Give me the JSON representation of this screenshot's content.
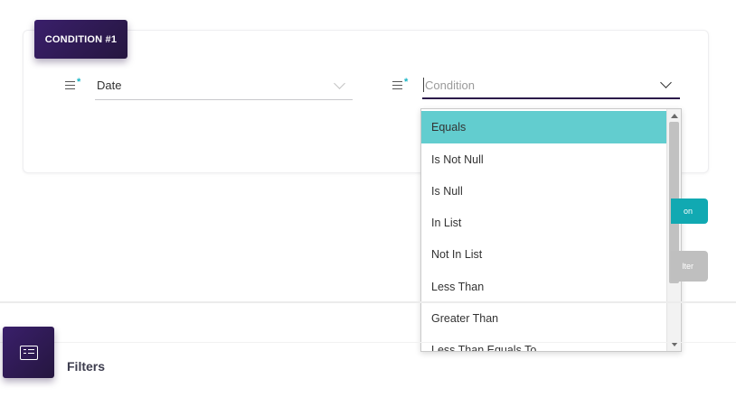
{
  "condition_card": {
    "badge_label": "CONDITION #1",
    "required_mark": "*",
    "field_icon": "lines-icon",
    "column_field": {
      "value": "Date"
    },
    "condition_field": {
      "placeholder": "Condition"
    }
  },
  "dropdown": {
    "options": [
      "Equals",
      "Is Not Null",
      "Is Null",
      "In List",
      "Not In List",
      "Less Than",
      "Greater Than",
      "Less Than Equals To"
    ],
    "selected": "Equals",
    "highlight_color": "#62cdcf"
  },
  "buttons": {
    "add_condition_partial": "on",
    "apply_filter_partial": "lter",
    "teal_color": "#11a9b2",
    "disabled_color": "#bfbfbf"
  },
  "filters_section": {
    "title": "Filters",
    "icon": "list-icon"
  },
  "colors": {
    "brand_dark": "#2b1a4a",
    "accent": "#17b3c4"
  }
}
